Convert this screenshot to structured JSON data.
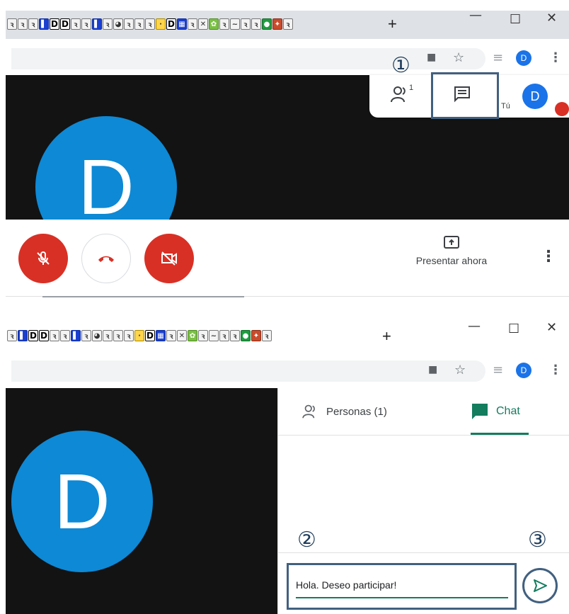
{
  "top": {
    "favicons": [
      "ꝛ",
      "ꝛ",
      "ꝛ",
      "▌",
      "D",
      "D",
      "ꝛ",
      "ꝛ",
      "▌",
      "ꝛ",
      "◕",
      "ꝛ",
      "ꝛ",
      "ꝛ",
      "·",
      "D",
      "▦",
      "ꝛ",
      "✕",
      "✿",
      "ꝛ",
      "~",
      "ꝛ",
      "ꝛ",
      "●",
      "✦",
      "ꝛ"
    ],
    "new_tab": "+",
    "window_controls": {
      "minimize": "—",
      "maximize": "☐",
      "close": "✕"
    },
    "browser_avatar": "D",
    "participants_count": "1",
    "you_label": "Tú",
    "avatar_letter": "D",
    "big_avatar_letter": "D",
    "present_label": "Presentar ahora",
    "more": "⋮",
    "step1": "①"
  },
  "bottom": {
    "favicons": [
      "ꝛ",
      "▌",
      "D",
      "D",
      "ꝛ",
      "ꝛ",
      "▌",
      "ꝛ",
      "◕",
      "ꝛ",
      "ꝛ",
      "ꝛ",
      "·",
      "D",
      "▦",
      "ꝛ",
      "✕",
      "✿",
      "ꝛ",
      "~",
      "ꝛ",
      "ꝛ",
      "●",
      "✦",
      "ꝛ"
    ],
    "new_tab": "+",
    "window_controls": {
      "minimize": "—",
      "maximize": "☐",
      "close": "✕"
    },
    "browser_avatar": "D",
    "big_avatar_letter": "D",
    "tab_people": "Personas (1)",
    "tab_chat": "Chat",
    "message_value": "Hola. Deseo participar!",
    "step2": "②",
    "step3": "③",
    "more": "⋮"
  },
  "colors": {
    "accent_green": "#137d5e",
    "danger_red": "#d93025",
    "avatar_blue": "#0d89d6",
    "highlight": "#41607f"
  }
}
